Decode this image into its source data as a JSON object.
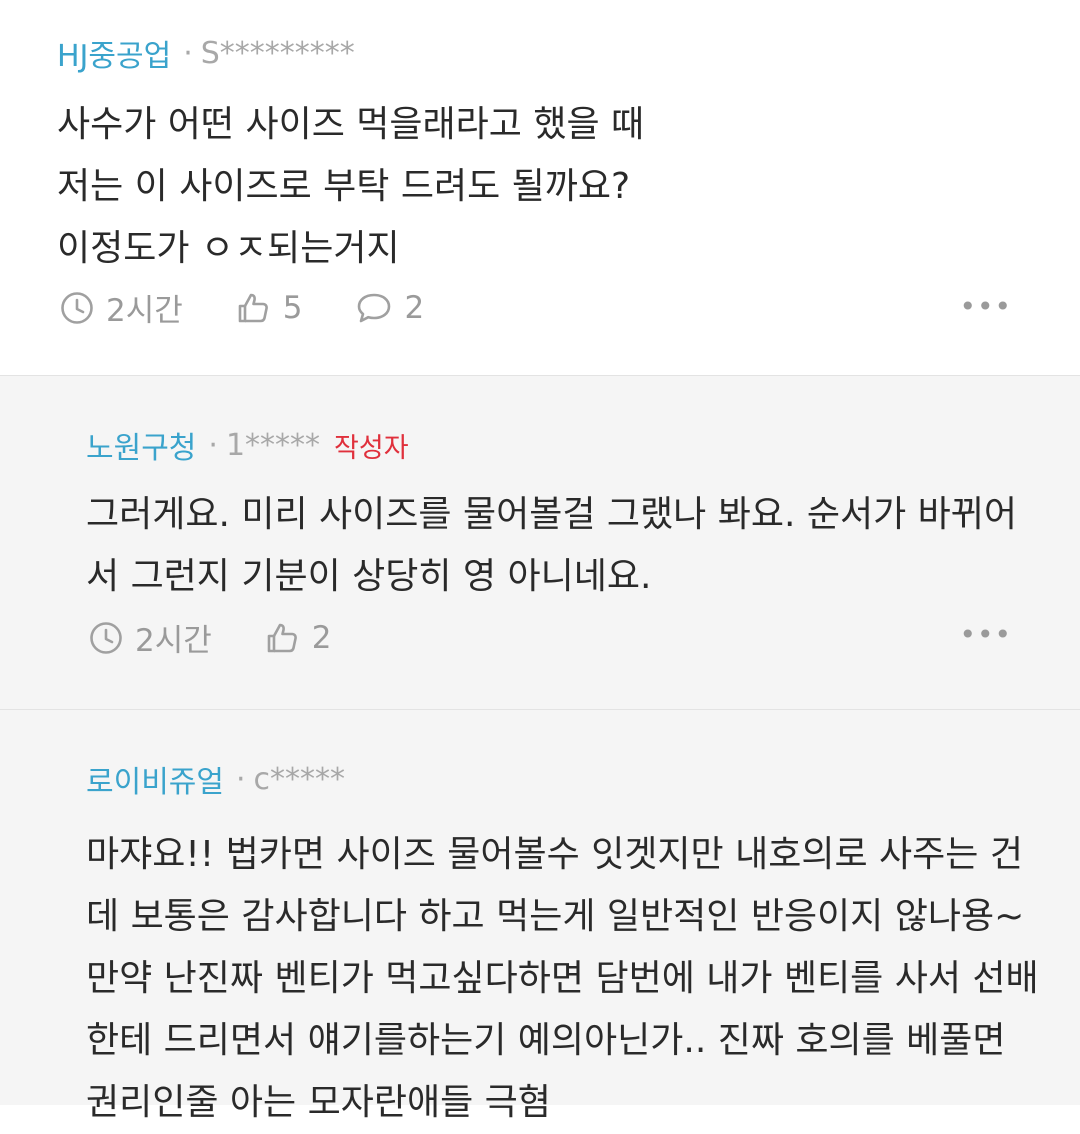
{
  "comments": [
    {
      "nickname": "HJ중공업",
      "separator": "·",
      "user_id": "S*********",
      "body": "사수가 어떤 사이즈 먹을래라고 했을 때\n저는 이 사이즈로 부탁 드려도 될까요?\n이정도가 ㅇㅈ되는거지",
      "time": "2시간",
      "likes": "5",
      "replies": "2",
      "more": "•••"
    },
    {
      "nickname": "노원구청",
      "separator": "·",
      "user_id": "1*****",
      "badge": "작성자",
      "body": "그러게요. 미리 사이즈를 물어볼걸 그랬나 봐요. 순서가 바뀌어서 그런지 기분이 상당히 영 아니네요.",
      "time": "2시간",
      "likes": "2",
      "more": "•••"
    },
    {
      "nickname": "로이비쥬얼",
      "separator": "·",
      "user_id": "c*****",
      "body": "마쟈요!! 법카면 사이즈 물어볼수 잇겟지만 내호의로 사주는 건데 보통은 감사합니다 하고 먹는게 일반적인 반응이지 않나용~ 만약 난진짜 벤티가 먹고싶다하면 담번에 내가 벤티를 사서 선배한테 드리면서 얘기를하는기 예의아닌가.. 진짜 호의를 베풀면 권리인줄 아는 모자란애들 극혐"
    }
  ],
  "colors": {
    "nickname": "#3aa3cc",
    "author_badge": "#e0303c",
    "muted": "#9a9a9a",
    "reply_bg": "#f5f5f5"
  },
  "icons": {
    "time": "clock-icon",
    "like": "thumbs-up-icon",
    "reply": "speech-bubble-icon",
    "more": "more-dots-icon"
  }
}
